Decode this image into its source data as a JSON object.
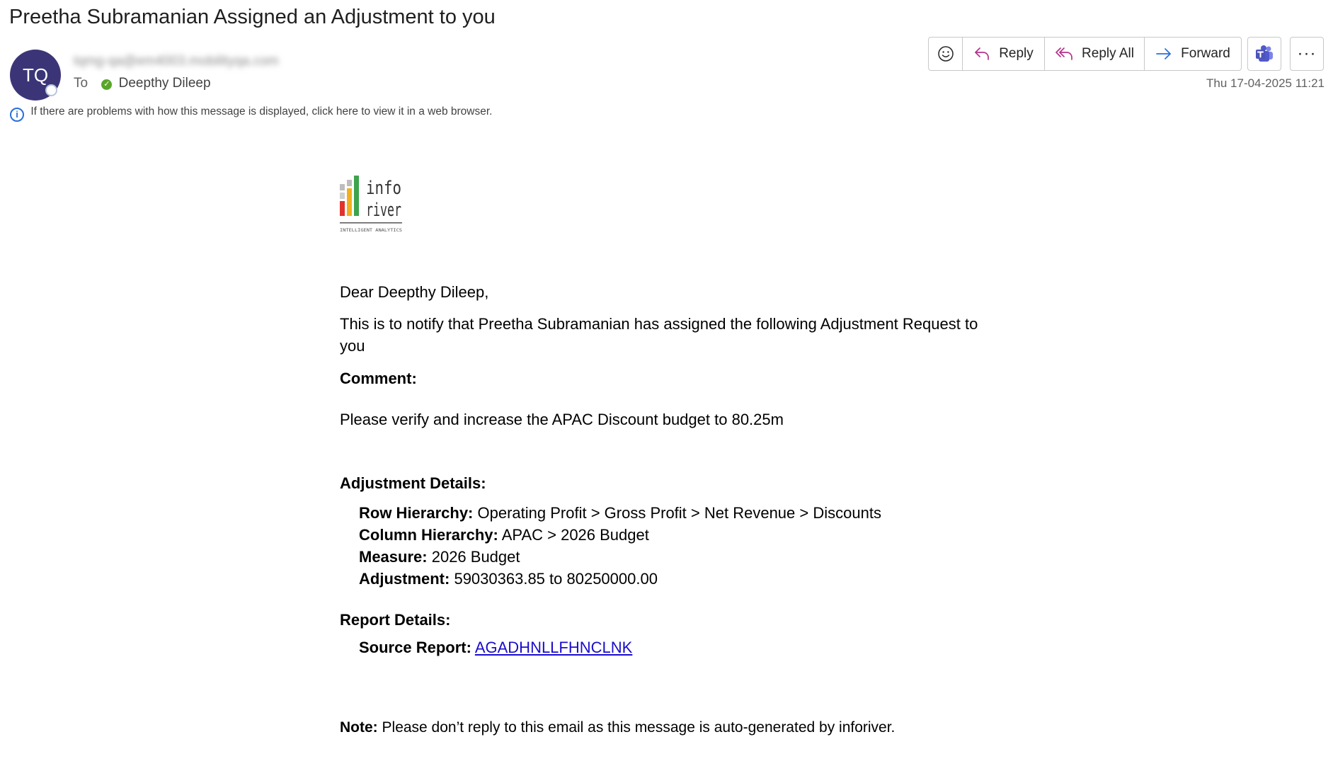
{
  "email": {
    "subject": "Preetha Subramanian Assigned an Adjustment to you",
    "avatar_initials": "TQ",
    "sender": "tqmg-qa@em4003.mobilityqa.com",
    "to_label": "To",
    "recipient": "Deepthy Dileep",
    "info_bar": "If there are problems with how this message is displayed, click here to view it in a web browser.",
    "date": "Thu 17-04-2025 11:21"
  },
  "toolbar": {
    "emoji_icon": "smiley-icon",
    "reply_label": "Reply",
    "reply_all_label": "Reply All",
    "forward_label": "Forward",
    "teams_icon": "teams-icon",
    "more_label": "···"
  },
  "logo": {
    "line1": "info",
    "line2": "river",
    "tagline": "INTELLIGENT ANALYTICS"
  },
  "body": {
    "greeting": "Dear Deepthy Dileep,",
    "intro": "This is to notify that Preetha Subramanian has assigned the following Adjustment Request to you",
    "comment_heading": "Comment:",
    "comment_text": "Please verify and increase the APAC Discount budget to 80.25m",
    "adjustment_heading": "Adjustment Details:",
    "row_hierarchy_label": "Row Hierarchy:",
    "row_hierarchy_value": "Operating Profit > Gross Profit > Net Revenue > Discounts",
    "column_hierarchy_label": "Column Hierarchy:",
    "column_hierarchy_value": "APAC > 2026 Budget",
    "measure_label": "Measure:",
    "measure_value": "2026 Budget",
    "adjustment_label": "Adjustment:",
    "adjustment_value": "59030363.85 to 80250000.00",
    "report_heading": "Report Details:",
    "source_report_label": "Source Report:",
    "source_report_link": "AGADHNLLFHNCLNK",
    "note_label": "Note:",
    "note_text": "Please don’t reply to this email as this message is auto-generated by inforiver."
  },
  "colors": {
    "avatar": "#3b3578",
    "accent_reply": "#b4338a",
    "accent_forward": "#2a6fdb",
    "link": "#1a0dcc",
    "teams": "#5059c9"
  }
}
